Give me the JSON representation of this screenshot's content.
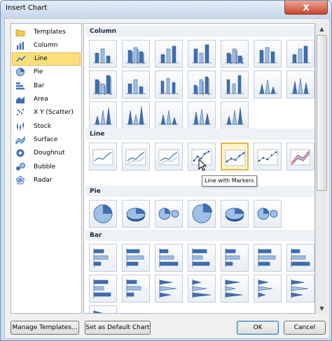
{
  "window": {
    "title": "Insert Chart",
    "close_glyph": "X"
  },
  "categories": [
    {
      "label": "Templates",
      "icon": "folder-icon"
    },
    {
      "label": "Column",
      "icon": "column-chart-icon"
    },
    {
      "label": "Line",
      "icon": "line-chart-icon",
      "selected": true
    },
    {
      "label": "Pie",
      "icon": "pie-chart-icon"
    },
    {
      "label": "Bar",
      "icon": "bar-chart-icon"
    },
    {
      "label": "Area",
      "icon": "area-chart-icon"
    },
    {
      "label": "X Y (Scatter)",
      "icon": "scatter-chart-icon"
    },
    {
      "label": "Stock",
      "icon": "stock-chart-icon"
    },
    {
      "label": "Surface",
      "icon": "surface-chart-icon"
    },
    {
      "label": "Doughnut",
      "icon": "doughnut-chart-icon"
    },
    {
      "label": "Bubble",
      "icon": "bubble-chart-icon"
    },
    {
      "label": "Radar",
      "icon": "radar-chart-icon"
    }
  ],
  "sections": [
    {
      "title": "Column",
      "tile_count": 19
    },
    {
      "title": "Line",
      "tile_count": 7,
      "highlighted_tile": 4
    },
    {
      "title": "Pie",
      "tile_count": 6
    },
    {
      "title": "Bar",
      "tile_count": 15
    }
  ],
  "tooltip": "Line with Markers",
  "buttons": {
    "manage_templates": "Manage Templates...",
    "set_default": "Set as Default Chart",
    "ok": "OK",
    "cancel": "Cancel"
  },
  "colors": {
    "accent_blue": "#3f6fb0",
    "selection": "#fbe07a",
    "highlight_border": "#e8b64a"
  }
}
